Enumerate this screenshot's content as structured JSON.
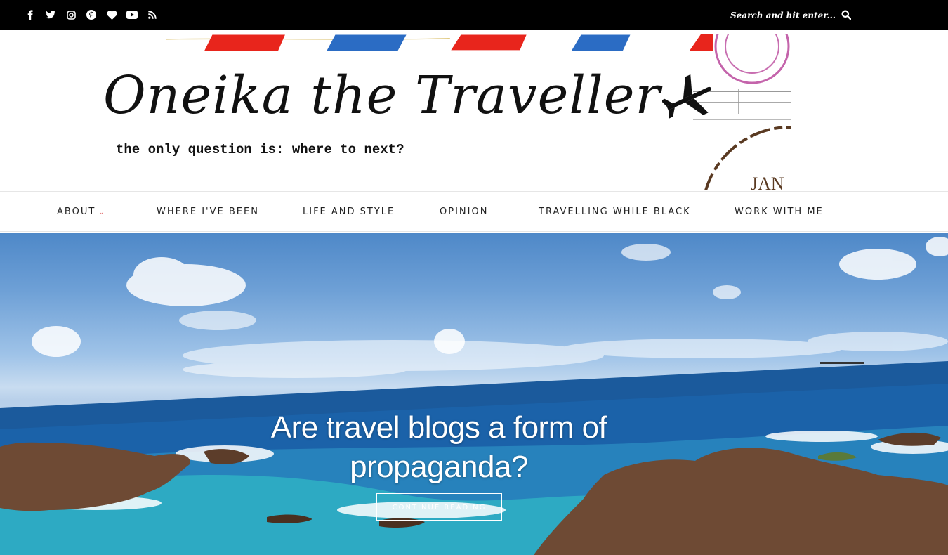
{
  "topbar": {
    "social_icons": [
      "facebook-icon",
      "twitter-icon",
      "instagram-icon",
      "pinterest-icon",
      "bloglovin-heart-icon",
      "youtube-icon",
      "rss-icon"
    ],
    "search": {
      "placeholder": "Search and hit enter...",
      "button_icon": "search-icon"
    }
  },
  "header": {
    "title": "Oneika the Traveller",
    "tagline": "the only question is: where to next?",
    "plane_icon": "airplane-icon",
    "postmark_text": "JAN"
  },
  "nav": {
    "items": [
      {
        "label": "ABOUT",
        "has_dropdown": true
      },
      {
        "label": "WHERE I'VE BEEN"
      },
      {
        "label": "LIFE AND STYLE"
      },
      {
        "label": "OPINION"
      },
      {
        "label": "TRAVELLING WHILE BLACK"
      },
      {
        "label": "WORK WITH ME"
      }
    ],
    "dropdown_icon": "chevron-down-icon"
  },
  "hero": {
    "title": "Are travel blogs a form of propaganda?",
    "cta_label": "CONTINUE READING"
  },
  "colors": {
    "topbar": "#000000",
    "nav_accent": "#e06666",
    "stripe_red": "#e8251c",
    "stripe_blue": "#2b6cc4"
  }
}
